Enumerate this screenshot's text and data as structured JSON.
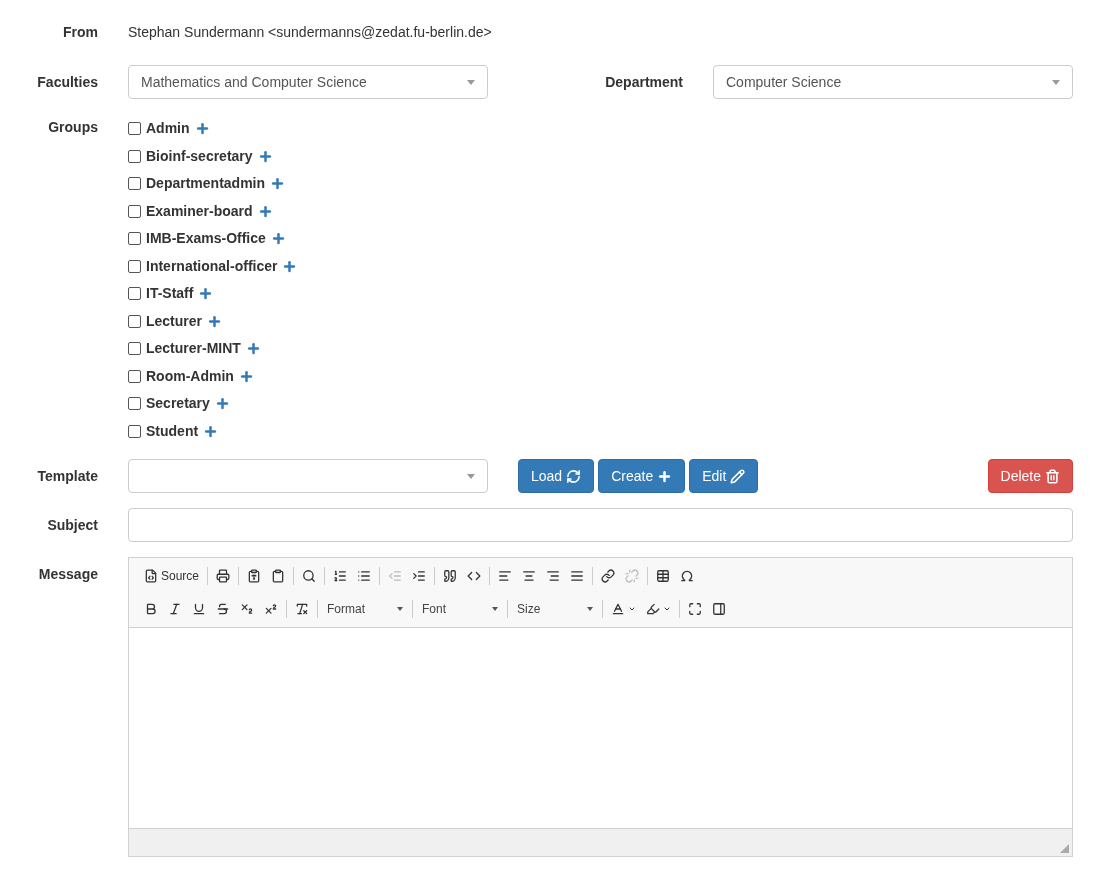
{
  "from": {
    "label": "From",
    "value": "Stephan Sundermann <sundermanns@zedat.fu-berlin.de>"
  },
  "faculties": {
    "label": "Faculties",
    "value": "Mathematics and Computer Science"
  },
  "department": {
    "label": "Department",
    "value": "Computer Science"
  },
  "groups": {
    "label": "Groups",
    "items": [
      {
        "name": "Admin",
        "checked": false
      },
      {
        "name": "Bioinf-secretary",
        "checked": false
      },
      {
        "name": "Departmentadmin",
        "checked": false
      },
      {
        "name": "Examiner-board",
        "checked": false
      },
      {
        "name": "IMB-Exams-Office",
        "checked": false
      },
      {
        "name": "International-officer",
        "checked": false
      },
      {
        "name": "IT-Staff",
        "checked": false
      },
      {
        "name": "Lecturer",
        "checked": false
      },
      {
        "name": "Lecturer-MINT",
        "checked": false
      },
      {
        "name": "Room-Admin",
        "checked": false
      },
      {
        "name": "Secretary",
        "checked": false
      },
      {
        "name": "Student",
        "checked": false
      }
    ]
  },
  "template": {
    "label": "Template",
    "buttons": [
      {
        "label": "Load",
        "kind": "load"
      },
      {
        "label": "Create",
        "kind": "create"
      },
      {
        "label": "Edit",
        "kind": "edit"
      },
      {
        "label": "Delete",
        "kind": "delete"
      }
    ]
  },
  "subject": {
    "label": "Subject"
  },
  "message": {
    "label": "Message",
    "toolbar": [
      [
        {
          "kind": "source",
          "label": "Source",
          "disabled": false
        },
        {
          "kind": "sep"
        },
        {
          "kind": "print",
          "disabled": false
        },
        {
          "kind": "sep"
        },
        {
          "kind": "paste-text",
          "disabled": false
        },
        {
          "kind": "paste-word",
          "disabled": false
        },
        {
          "kind": "sep"
        },
        {
          "kind": "find",
          "disabled": false
        },
        {
          "kind": "sep"
        },
        {
          "kind": "numbered-list",
          "disabled": false
        },
        {
          "kind": "bulleted-list",
          "disabled": false
        },
        {
          "kind": "sep"
        },
        {
          "kind": "outdent",
          "disabled": true
        },
        {
          "kind": "indent",
          "disabled": false
        },
        {
          "kind": "sep"
        },
        {
          "kind": "quote",
          "disabled": false
        },
        {
          "kind": "div",
          "disabled": false
        },
        {
          "kind": "sep"
        },
        {
          "kind": "align-left",
          "disabled": false
        },
        {
          "kind": "align-center",
          "disabled": false
        },
        {
          "kind": "align-right",
          "disabled": false
        },
        {
          "kind": "justify",
          "disabled": false
        },
        {
          "kind": "sep"
        },
        {
          "kind": "link",
          "disabled": false
        },
        {
          "kind": "unlink",
          "disabled": true
        },
        {
          "kind": "sep"
        },
        {
          "kind": "table",
          "disabled": false
        },
        {
          "kind": "special-char",
          "disabled": false
        }
      ],
      [
        {
          "kind": "bold",
          "disabled": false
        },
        {
          "kind": "italic",
          "disabled": false
        },
        {
          "kind": "underline",
          "disabled": false
        },
        {
          "kind": "strike",
          "disabled": false
        },
        {
          "kind": "subscript",
          "disabled": false
        },
        {
          "kind": "superscript",
          "disabled": false
        },
        {
          "kind": "sep"
        },
        {
          "kind": "remove-format",
          "disabled": false
        },
        {
          "kind": "sep"
        },
        {
          "kind": "combo",
          "label": "Format"
        },
        {
          "kind": "sep"
        },
        {
          "kind": "combo",
          "label": "Font"
        },
        {
          "kind": "sep"
        },
        {
          "kind": "combo",
          "label": "Size"
        },
        {
          "kind": "sep"
        },
        {
          "kind": "text-color",
          "disabled": false
        },
        {
          "kind": "bg-color",
          "disabled": false
        },
        {
          "kind": "sep"
        },
        {
          "kind": "maximize",
          "disabled": false
        },
        {
          "kind": "blocks",
          "disabled": false
        }
      ]
    ]
  }
}
